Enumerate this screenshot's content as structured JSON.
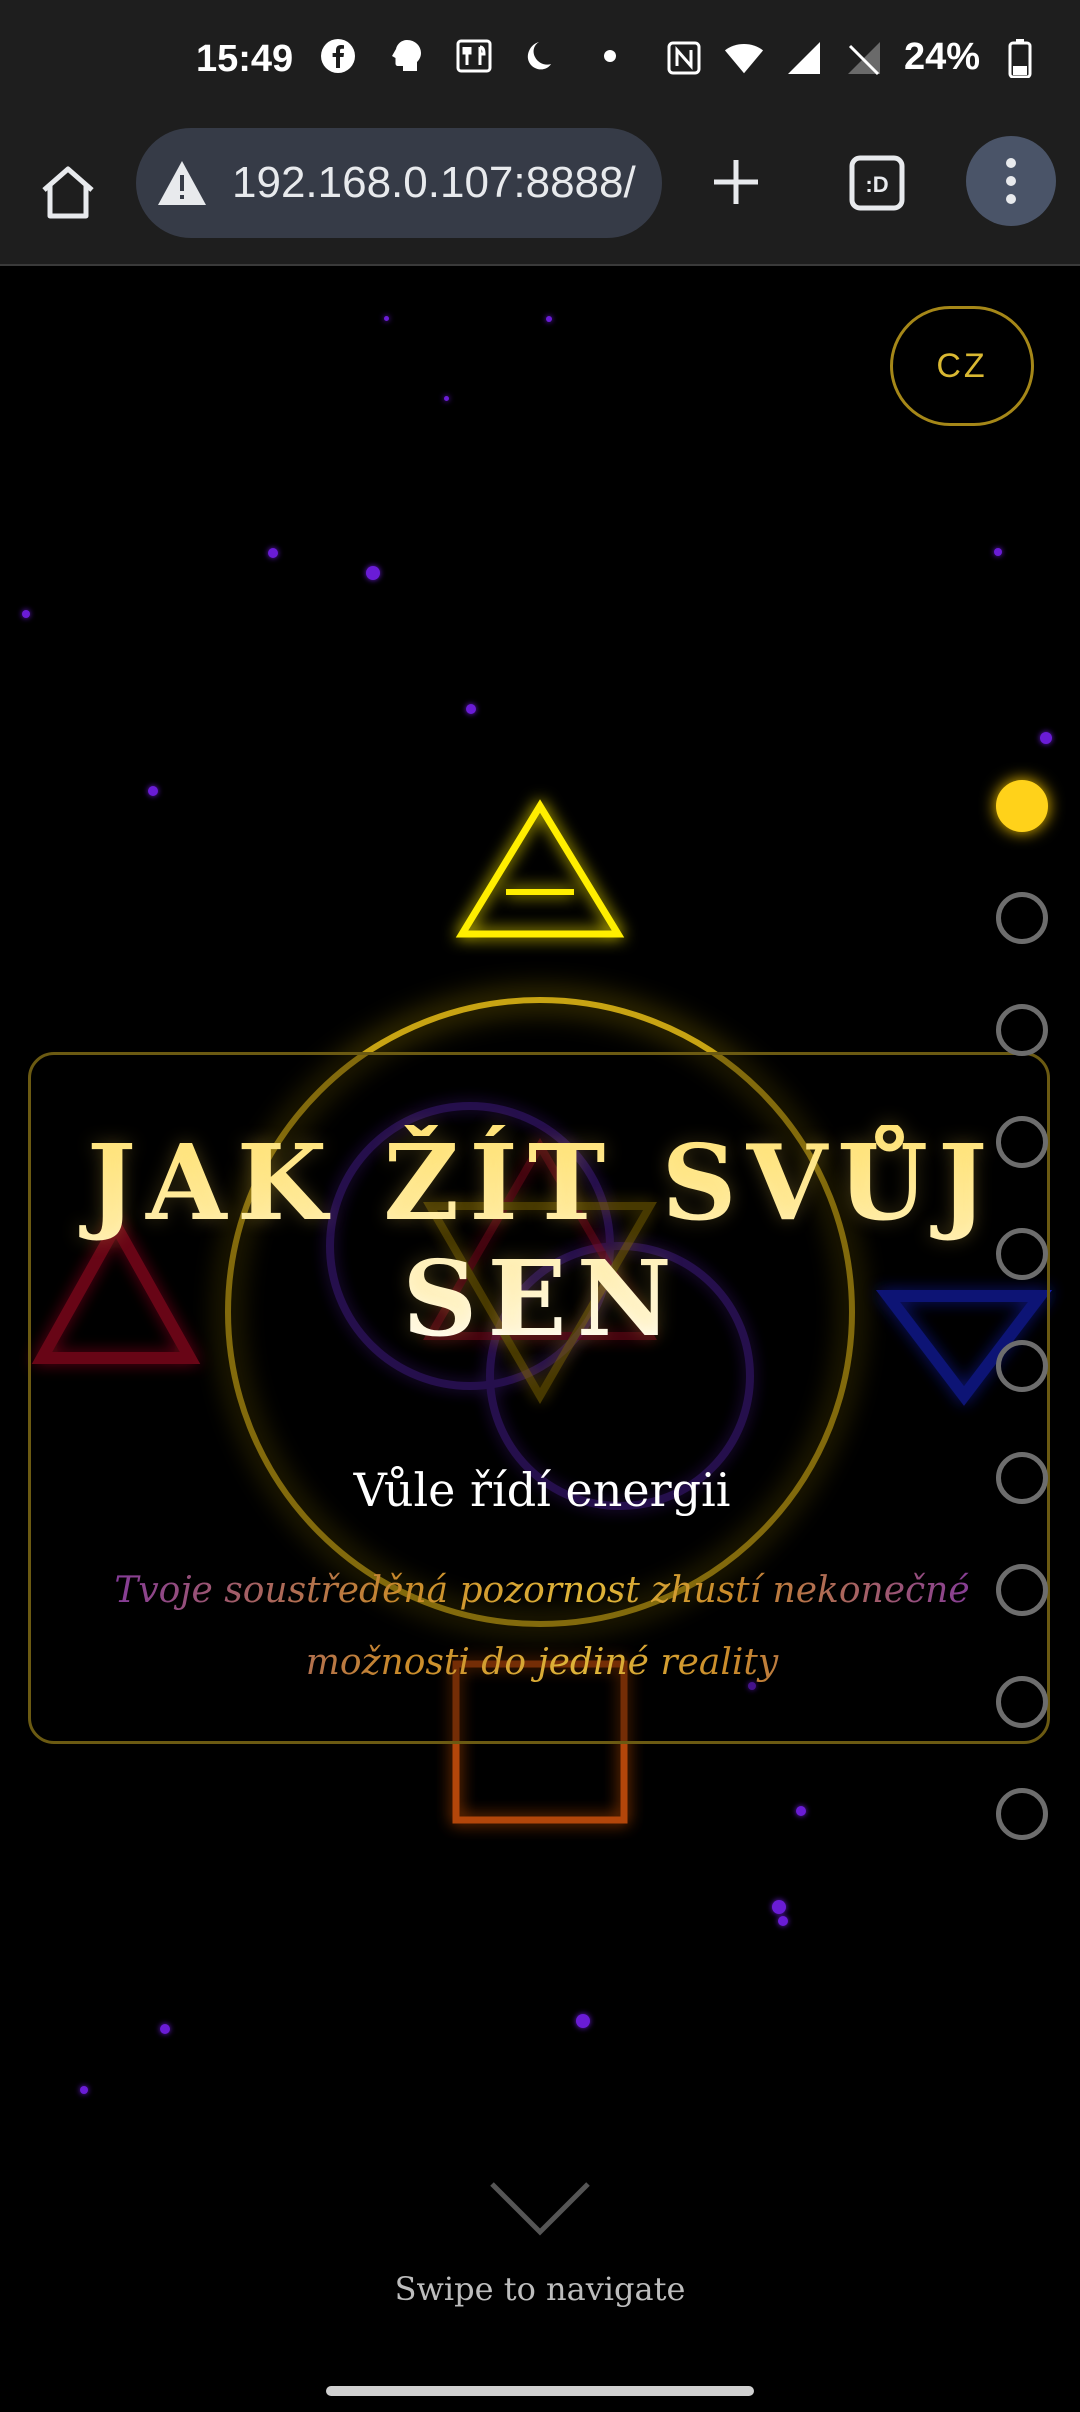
{
  "status_bar": {
    "time": "15:49",
    "battery": "24%",
    "left_icons": [
      "facebook-icon",
      "profile-icon",
      "restaurant-icon",
      "moon-icon",
      "dot-icon"
    ],
    "right_icons": [
      "nfc-icon",
      "wifi-icon",
      "cell-signal-icon",
      "no-sim-icon",
      "battery-icon"
    ]
  },
  "browser": {
    "url": "192.168.0.107:8888/",
    "security_icon": "warning-icon"
  },
  "page": {
    "language_button": "CZ",
    "title_line1": "JAK ŽÍT SVŮJ",
    "title_line2": "SEN",
    "subtitle": "Vůle řídí energii",
    "description": "Tvoje soustředěná pozornost zhustí nekonečné možnosti do jediné reality",
    "swipe_hint": "Swipe to navigate",
    "nav_dots": {
      "total": 10,
      "active_index": 0
    }
  },
  "colors": {
    "accent_gold": "#ffd21a",
    "fire_red": "#c0102a",
    "water_blue": "#1a2bd6",
    "earth_orange": "#d9570f",
    "spirit_purple": "#6a1cd6"
  }
}
